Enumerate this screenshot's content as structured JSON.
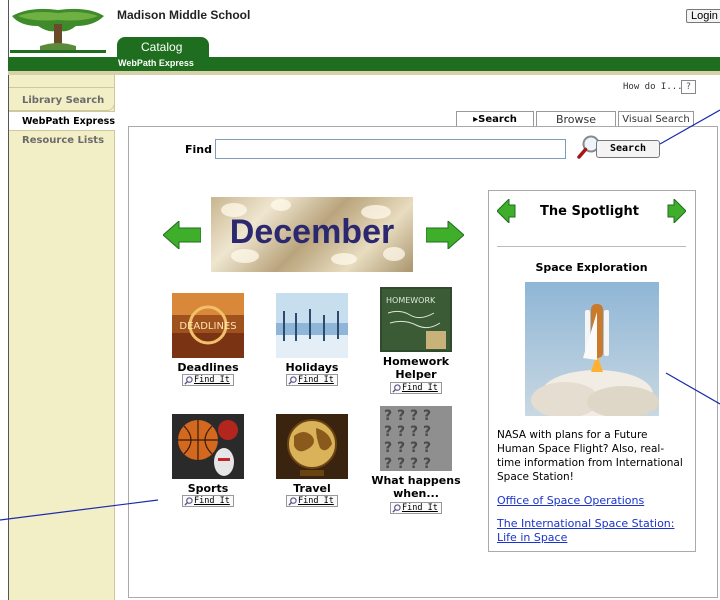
{
  "header": {
    "school_name": "Madison Middle School",
    "login_label": "Login",
    "catalog_tab": "Catalog",
    "sub_title": "WebPath Express"
  },
  "sidebar": {
    "items": [
      {
        "label": "Library Search"
      },
      {
        "label": "WebPath Express"
      },
      {
        "label": "Resource Lists"
      }
    ]
  },
  "help": {
    "how_do_i": "How do I...",
    "help_icon": "?"
  },
  "tabs": [
    {
      "label": "Search"
    },
    {
      "label": "Browse"
    },
    {
      "label": "Visual Search"
    }
  ],
  "search": {
    "find_label": "Find",
    "value": "",
    "button_label": "Search"
  },
  "banner": {
    "month": "December"
  },
  "topics": [
    {
      "label": "Deadlines",
      "find": "Find It"
    },
    {
      "label": "Holidays",
      "find": "Find It"
    },
    {
      "label": "Homework Helper",
      "find": "Find It"
    },
    {
      "label": "Sports",
      "find": "Find It"
    },
    {
      "label": "Travel",
      "find": "Find It"
    },
    {
      "label": "What happens when...",
      "find": "Find It"
    }
  ],
  "spotlight": {
    "title": "The Spotlight",
    "subject": "Space Exploration",
    "description": "NASA with plans for a Future Human Space Flight? Also, real-time information from International Space Station!",
    "links": [
      "Office of Space Operations",
      "The International Space Station: Life in Space"
    ]
  },
  "image_text": {
    "deadlines": "DEADLINES",
    "homework": "HOMEWORK"
  },
  "colors": {
    "brand_green": "#1f6e1f",
    "sidebar_bg": "#f2efc6",
    "link_blue": "#1a33cc",
    "banner_text": "#2b2870"
  }
}
